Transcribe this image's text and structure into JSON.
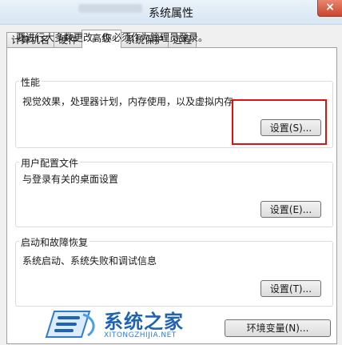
{
  "window": {
    "title": "系统属性",
    "close_glyph": "×"
  },
  "tabs": [
    {
      "label": "计算机名"
    },
    {
      "label": "硬件"
    },
    {
      "label": "高级"
    },
    {
      "label": "系统保护"
    },
    {
      "label": "远程"
    }
  ],
  "active_tab": "高级",
  "admin_note": "要进行大多数更改，你必须作为管理员登录。",
  "performance": {
    "legend": "性能",
    "description": "视觉效果，处理器计划，内存使用，以及虚拟内存",
    "button": "设置(S)..."
  },
  "user_profiles": {
    "legend": "用户配置文件",
    "description": "与登录有关的桌面设置",
    "button": "设置(E)..."
  },
  "startup_recovery": {
    "legend": "启动和故障恢复",
    "description": "系统启动、系统失败和调试信息",
    "button": "设置(T)..."
  },
  "env_button": "环境变量(N)...",
  "watermark": {
    "brand": "系统之家",
    "url": "XITONGZHIJIA.NET"
  },
  "colors": {
    "highlight": "#e01010",
    "watermark_blue": "#1f63b5"
  }
}
